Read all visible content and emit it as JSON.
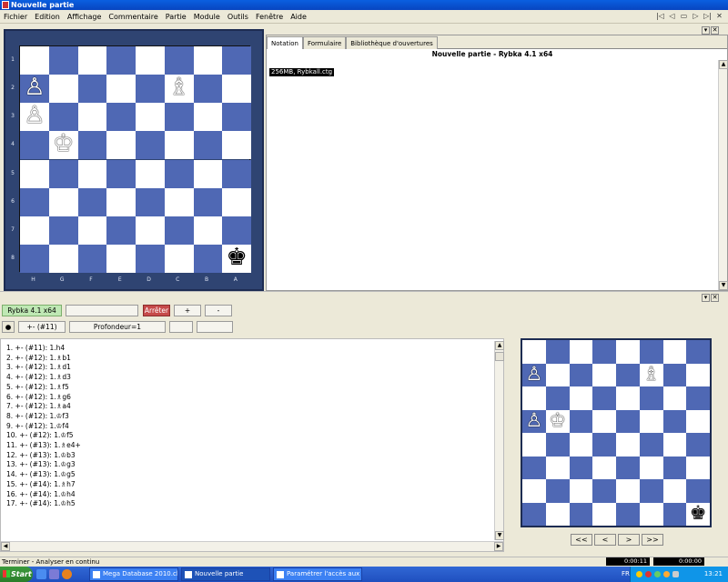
{
  "title_bar": {
    "title": "Nouvelle partie"
  },
  "menu": [
    "Fichier",
    "Edition",
    "Affichage",
    "Commentaire",
    "Partie",
    "Module",
    "Outils",
    "Fenêtre",
    "Aide"
  ],
  "toolbar_icons": [
    "skip-first-icon",
    "prev-icon",
    "comment-icon",
    "next-icon",
    "skip-last-icon",
    "close-icon"
  ],
  "main_board": {
    "ranks": [
      "1",
      "2",
      "3",
      "4",
      "5",
      "6",
      "7",
      "8"
    ],
    "files": [
      "H",
      "G",
      "F",
      "E",
      "D",
      "C",
      "B",
      "A"
    ],
    "pieces": [
      {
        "glyph": "♙",
        "name": "white-pawn",
        "col": 0,
        "row": 1
      },
      {
        "glyph": "♗",
        "name": "white-bishop",
        "col": 5,
        "row": 1
      },
      {
        "glyph": "♙",
        "name": "white-pawn",
        "col": 0,
        "row": 2
      },
      {
        "glyph": "♔",
        "name": "white-king",
        "col": 1,
        "row": 3
      },
      {
        "glyph": "♚",
        "name": "black-king",
        "col": 7,
        "row": 7
      }
    ]
  },
  "notation": {
    "tabs": [
      "Notation",
      "Formulaire",
      "Bibliothèque d'ouvertures"
    ],
    "header": "Nouvelle partie - Rybka 4.1 x64",
    "book": "256MB, Rybkall.ctg"
  },
  "engine": {
    "name": "Rybka 4.1 x64",
    "stop": "Arrêter",
    "plus": "+",
    "minus": "-",
    "eval": "+- (#11)",
    "depth": "Profondeur=1"
  },
  "analysis_lines": [
    "1. +- (#11): 1.h4",
    "2. +- (#12): 1.♗b1",
    "3. +- (#12): 1.♗d1",
    "4. +- (#12): 1.♗d3",
    "5. +- (#12): 1.♗f5",
    "6. +- (#12): 1.♗g6",
    "7. +- (#12): 1.♗a4",
    "8. +- (#12): 1.♔f3",
    "9. +- (#12): 1.♔f4",
    "10. +- (#12): 1.♔f5",
    "11. +- (#13): 1.♗e4+",
    "12. +- (#13): 1.♔b3",
    "13. +- (#13): 1.♔g3",
    "14. +- (#13): 1.♔g5",
    "15. +- (#14): 1.♗h7",
    "16. +- (#14): 1.♔h4",
    "17. +- (#14): 1.♔h5"
  ],
  "mini_board": {
    "pieces": [
      {
        "glyph": "♙",
        "name": "white-pawn",
        "col": 0,
        "row": 1
      },
      {
        "glyph": "♗",
        "name": "white-bishop",
        "col": 5,
        "row": 1
      },
      {
        "glyph": "♙",
        "name": "white-pawn",
        "col": 0,
        "row": 3
      },
      {
        "glyph": "♔",
        "name": "white-king",
        "col": 1,
        "row": 3
      },
      {
        "glyph": "♚",
        "name": "black-king",
        "col": 7,
        "row": 7
      }
    ]
  },
  "nav": [
    "<<",
    "<",
    ">",
    ">>"
  ],
  "status": {
    "text": "Terminer - Analyser en continu",
    "time1": "0:00:11",
    "time2": "0:00:00"
  },
  "taskbar": {
    "start": "Start",
    "tasks": [
      "Mega Database 2010.cb...",
      "Nouvelle partie",
      "Paramétrer l'accès aux t..."
    ],
    "lang": "FR",
    "clock": "13:21"
  }
}
